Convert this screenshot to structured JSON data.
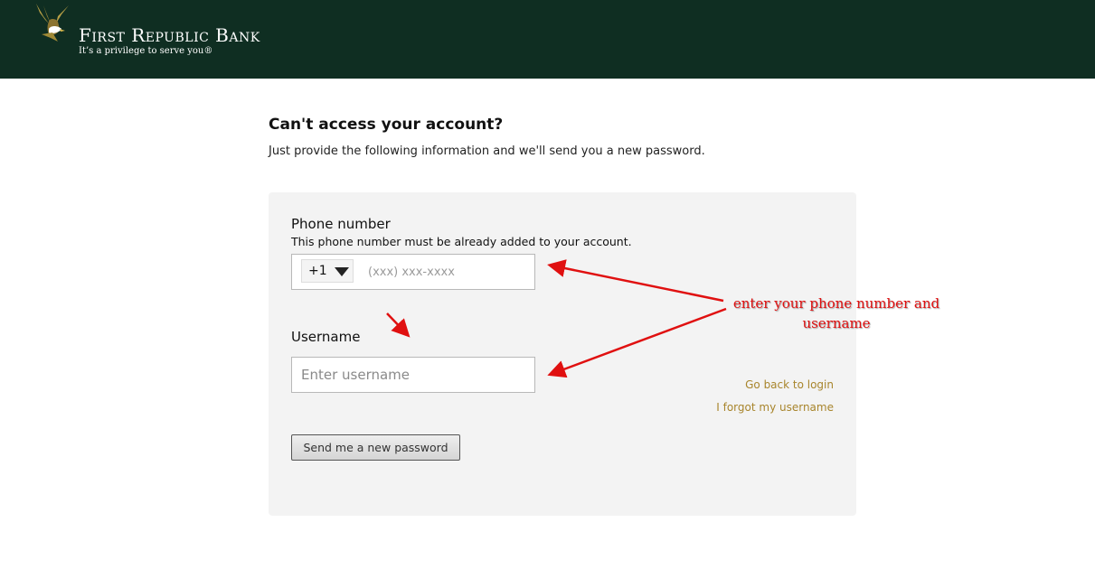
{
  "header": {
    "brand_name": "First Republic Bank",
    "tagline": "It’s a privilege to serve you®",
    "background_color": "#0f2e22",
    "logo_icon": "eagle-icon"
  },
  "main": {
    "title": "Can't access your account?",
    "subtitle": "Just provide the following information and we'll send you a new password."
  },
  "form": {
    "phone": {
      "label": "Phone number",
      "help_text": "This phone number must be already added to your account.",
      "country_code": "+1",
      "placeholder": "(xxx) xxx-xxxx",
      "value": ""
    },
    "username": {
      "label": "Username",
      "placeholder": "Enter username",
      "value": ""
    },
    "links": {
      "back_to_login": "Go back to login",
      "forgot_username": "I forgot my username"
    },
    "submit_label": "Send me a new password"
  },
  "annotation": {
    "text": "enter your phone number and username",
    "color": "#e01010"
  },
  "colors": {
    "link": "#a8852c",
    "panel": "#f3f3f3"
  }
}
